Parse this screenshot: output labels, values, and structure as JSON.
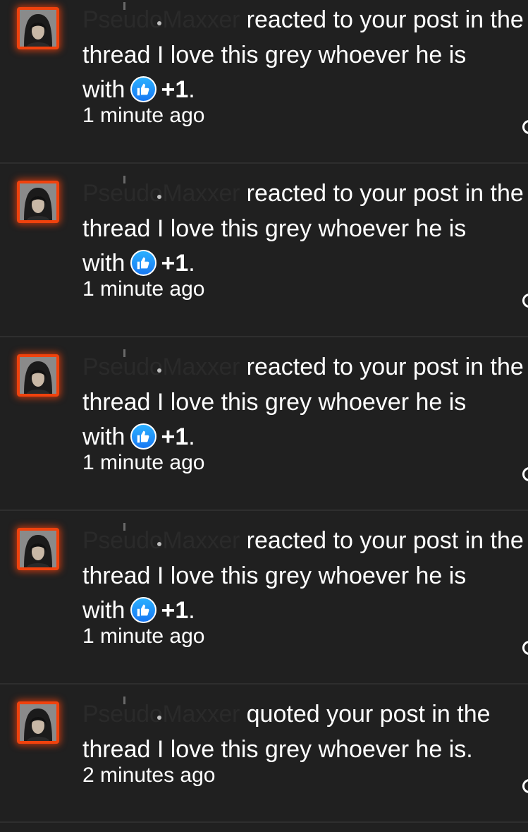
{
  "notifications": [
    {
      "user": "PseudoMaxxer",
      "action": "reacted to your post in the thread I love this grey whoever he is",
      "with_label": "with",
      "reaction_icon": "thumbs-up-icon",
      "reaction_count": "+1",
      "period": ".",
      "time": "1 minute ago"
    },
    {
      "user": "PseudoMaxxer",
      "action": "reacted to your post in the thread I love this grey whoever he is",
      "with_label": "with",
      "reaction_icon": "thumbs-up-icon",
      "reaction_count": "+1",
      "period": ".",
      "time": "1 minute ago"
    },
    {
      "user": "PseudoMaxxer",
      "action": "reacted to your post in the thread I love this grey whoever he is",
      "with_label": "with",
      "reaction_icon": "thumbs-up-icon",
      "reaction_count": "+1",
      "period": ".",
      "time": "1 minute ago"
    },
    {
      "user": "PseudoMaxxer",
      "action": "reacted to your post in the thread I love this grey whoever he is",
      "with_label": "with",
      "reaction_icon": "thumbs-up-icon",
      "reaction_count": "+1",
      "period": ".",
      "time": "1 minute ago"
    },
    {
      "user": "PseudoMaxxer",
      "action": "quoted your post in the thread I love this grey whoever he is.",
      "time": "2 minutes ago"
    }
  ],
  "colors": {
    "background": "#202020",
    "avatar_border": "#f0420d",
    "reaction_blue": "#1a86f5",
    "text": "#ffffff"
  }
}
